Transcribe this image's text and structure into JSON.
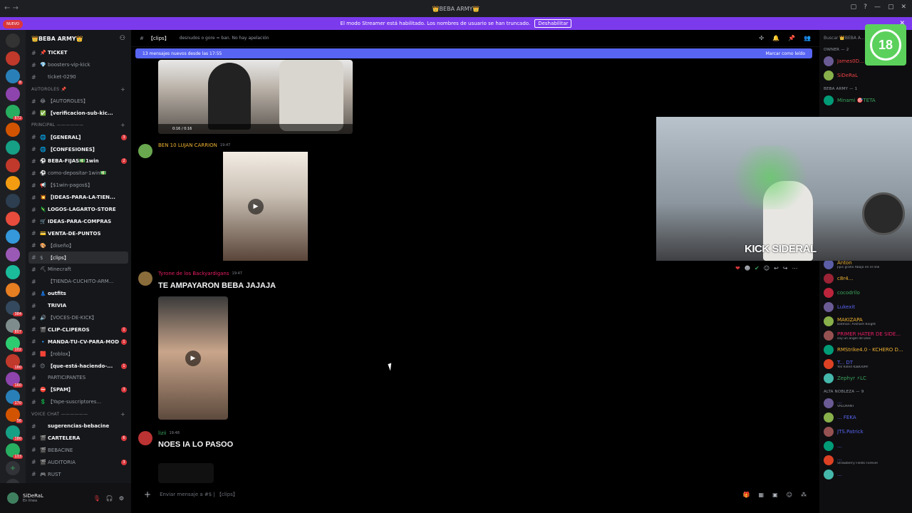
{
  "window": {
    "title": "👑BEBA ARMY👑",
    "nav": "← →",
    "controls": [
      "▢",
      "?",
      "—",
      "▢",
      "✕"
    ]
  },
  "banner": {
    "text": "El modo Streamer está habilitado. Los nombres de usuario se han truncado.",
    "button": "Deshabilitar",
    "close": "✕"
  },
  "rail": {
    "nuevo": "NUEVO",
    "servers": [
      {
        "color": "#333",
        "badge": ""
      },
      {
        "color": "#c0392b",
        "badge": ""
      },
      {
        "color": "#2980b9",
        "badge": "8"
      },
      {
        "color": "#8e44ad",
        "badge": ""
      },
      {
        "color": "#27ae60",
        "badge": "672"
      },
      {
        "color": "#d35400",
        "badge": ""
      },
      {
        "color": "#16a085",
        "badge": ""
      },
      {
        "color": "#c0392b",
        "badge": ""
      },
      {
        "color": "#f39c12",
        "badge": ""
      },
      {
        "color": "#2c3e50",
        "badge": ""
      },
      {
        "color": "#e74c3c",
        "badge": ""
      },
      {
        "color": "#3498db",
        "badge": ""
      },
      {
        "color": "#9b59b6",
        "badge": ""
      },
      {
        "color": "#1abc9c",
        "badge": ""
      },
      {
        "color": "#e67e22",
        "badge": ""
      },
      {
        "color": "#34495e",
        "badge": "384"
      },
      {
        "color": "#7f8c8d",
        "badge": "807"
      },
      {
        "color": "#2ecc71",
        "badge": "102"
      },
      {
        "color": "#c0392b",
        "badge": "180"
      },
      {
        "color": "#8e44ad",
        "badge": "160"
      },
      {
        "color": "#2980b9",
        "badge": "170"
      },
      {
        "color": "#d35400",
        "badge": "56"
      },
      {
        "color": "#16a085",
        "badge": "180"
      },
      {
        "color": "#27ae60",
        "badge": "133"
      }
    ],
    "add": "+",
    "discover": "◎"
  },
  "sidebar": {
    "server_name": "👑BEBA ARMY👑",
    "items": [
      {
        "type": "ch",
        "emoji": "📌",
        "name": "TICKET",
        "bold": true,
        "badge": ""
      },
      {
        "type": "ch",
        "emoji": "💎",
        "name": "boosters-vip-kick",
        "bold": false,
        "badge": ""
      },
      {
        "type": "ch",
        "emoji": "",
        "name": "ticket-0290",
        "bold": false,
        "badge": ""
      },
      {
        "type": "cat",
        "name": "AUTOROLES 📌"
      },
      {
        "type": "ch",
        "emoji": "😂",
        "name": "【AUTOROLES】",
        "bold": false,
        "badge": ""
      },
      {
        "type": "ch",
        "emoji": "✅",
        "name": "【verificacion-sub-kic...",
        "bold": true,
        "badge": ""
      },
      {
        "type": "cat",
        "name": "PRINCIPAL ——————"
      },
      {
        "type": "ch",
        "emoji": "🌐",
        "name": "【GENERAL】",
        "bold": true,
        "badge": "3"
      },
      {
        "type": "ch",
        "emoji": "🌐",
        "name": "【CONFESIONES】",
        "bold": true,
        "badge": ""
      },
      {
        "type": "ch",
        "emoji": "⚽",
        "name": "BEBA-FIJAS💵1win",
        "bold": true,
        "badge": "2"
      },
      {
        "type": "ch",
        "emoji": "⚽",
        "name": "como-depositar-1win💵",
        "bold": false,
        "badge": ""
      },
      {
        "type": "ch",
        "emoji": "📢",
        "name": "【$1win-pagos$】",
        "bold": false,
        "badge": ""
      },
      {
        "type": "ch",
        "emoji": "💥",
        "name": "【IDEAS-PARA-LA-TIEN...",
        "bold": true,
        "badge": ""
      },
      {
        "type": "ch",
        "emoji": "🦎",
        "name": "LOGOS-LAGARTO-STORE",
        "bold": true,
        "badge": ""
      },
      {
        "type": "ch",
        "emoji": "🛒",
        "name": "IDEAS-PARA-COMPRAS",
        "bold": true,
        "badge": ""
      },
      {
        "type": "ch",
        "emoji": "💳",
        "name": "VENTA-DE-PUNTOS",
        "bold": true,
        "badge": ""
      },
      {
        "type": "ch",
        "emoji": "🎨",
        "name": "【diseño】",
        "bold": false,
        "badge": ""
      },
      {
        "type": "ch",
        "emoji": "$",
        "name": "【clips】",
        "bold": false,
        "badge": "",
        "active": true
      },
      {
        "type": "ch",
        "emoji": "⛏",
        "name": "Minecraft",
        "bold": false,
        "badge": ""
      },
      {
        "type": "ch",
        "emoji": "",
        "name": "【TIENDA-CUCHITO-ARM...",
        "bold": false,
        "badge": ""
      },
      {
        "type": "ch",
        "emoji": "👗",
        "name": "outfits",
        "bold": true,
        "badge": ""
      },
      {
        "type": "ch",
        "emoji": "",
        "name": "TRIVIA",
        "bold": true,
        "badge": ""
      },
      {
        "type": "ch",
        "emoji": "🔊",
        "name": "【VOCES-DE-KICK】",
        "bold": false,
        "badge": ""
      },
      {
        "type": "ch",
        "emoji": "🎬",
        "name": "CLIP-CLIPEROS",
        "bold": true,
        "badge": "1"
      },
      {
        "type": "ch",
        "emoji": "🔹",
        "name": "MANDA-TU-CV-PARA-MOD",
        "bold": true,
        "badge": "1"
      },
      {
        "type": "ch",
        "emoji": "🟥",
        "name": "【roblox】",
        "bold": false,
        "badge": ""
      },
      {
        "type": "ch",
        "emoji": "😊",
        "name": "【que-está-haciendo-...",
        "bold": true,
        "badge": "1"
      },
      {
        "type": "ch",
        "emoji": "",
        "name": "PARTICIPANTES",
        "bold": false,
        "badge": ""
      },
      {
        "type": "ch",
        "emoji": "⛔",
        "name": "【SPAM】",
        "bold": true,
        "badge": "3"
      },
      {
        "type": "ch",
        "emoji": "💲",
        "name": "【Yape-suscriptores...",
        "bold": false,
        "badge": ""
      },
      {
        "type": "cat",
        "name": "VOICE CHAT ——————"
      },
      {
        "type": "ch",
        "emoji": "",
        "name": "sugerencias-bebacine",
        "bold": true,
        "badge": ""
      },
      {
        "type": "ch",
        "emoji": "🎬",
        "name": "CARTELERA",
        "bold": true,
        "badge": "6"
      },
      {
        "type": "ch",
        "emoji": "🎬",
        "name": "BEBACINE",
        "bold": false,
        "badge": ""
      },
      {
        "type": "ch",
        "emoji": "🎬",
        "name": "AUDITORIA",
        "bold": false,
        "badge": "3"
      },
      {
        "type": "ch",
        "emoji": "🎮",
        "name": "RUST",
        "bold": false,
        "badge": ""
      }
    ]
  },
  "user": {
    "name": "SiDeRaL",
    "status": "En línea"
  },
  "channel": {
    "name": "【clips】",
    "topic": "desnudos o gore = ban. No hay apelación",
    "new_messages": "13 mensajes nuevos desde las 17:55",
    "mark_read": "Marcar como leído"
  },
  "video_time": "0:16 / 0:16",
  "messages": [
    {
      "author": "BEN 10 LUJAN CARRION",
      "time": "19:47",
      "color": "#f0b232",
      "text": ""
    },
    {
      "author": "Tyrone de los Backyardigans",
      "time": "19:47",
      "color": "#e91e63",
      "text": "TE AMPAYARON BEBA JAJAJA"
    },
    {
      "author": "lizii",
      "time": "19:48",
      "color": "#3ba55d",
      "text": "NOES IA LO PASOO"
    }
  ],
  "composer": {
    "placeholder": "Enviar mensaje a #$ | 【clips】"
  },
  "members": {
    "search": "Buscar 👑BEBA A...",
    "groups": [
      {
        "title": "OWNER — 2",
        "people": [
          {
            "name": "James0D...",
            "sub": "",
            "color": "#ed4245"
          },
          {
            "name": "SiDeRaL",
            "sub": "",
            "color": "#ed4245"
          }
        ]
      },
      {
        "title": "BEBA ARMY — 1",
        "people": [
          {
            "name": "Minami 🎯TETA",
            "sub": "",
            "color": "#3ba55d"
          }
        ]
      },
      {
        "title": "",
        "people": [
          {
            "name": "Anton",
            "sub": "Jipis gratis Abajo en el link",
            "color": "#f0b232"
          },
          {
            "name": "c8r4...",
            "sub": "",
            "color": "#f0b232"
          },
          {
            "name": "cocodrilo",
            "sub": "",
            "color": "#3ba55d"
          },
          {
            "name": "Lukexit",
            "sub": "",
            "color": "#5865f2"
          },
          {
            "name": "MAKIZAPA",
            "sub": "Batman: Arkham Knight",
            "color": "#f0b232"
          },
          {
            "name": "PRIMER HATER DE SIDE...",
            "sub": "soy un angel de Dios",
            "color": "#e91e63"
          },
          {
            "name": "RMStrike4.0 - KCHERO D...",
            "sub": "",
            "color": "#f0b232"
          },
          {
            "name": "T... DT",
            "sub": "Yes Killed KaBOOM!",
            "color": "#5865f2"
          },
          {
            "name": "Zephyr ⚡LC",
            "sub": "",
            "color": "#3ba55d"
          }
        ]
      },
      {
        "title": "ALTA NOBLEZA — 9",
        "people": [
          {
            "name": "...",
            "sub": "VALORANT",
            "color": "#5865f2"
          },
          {
            "name": "... FEKA",
            "sub": "",
            "color": "#5865f2"
          },
          {
            "name": "JTS.Patrick",
            "sub": "",
            "color": "#5865f2"
          },
          {
            "name": "...",
            "sub": "",
            "color": "#5865f2"
          },
          {
            "name": "...",
            "sub": "Strawberry Fields Forever",
            "color": "#5865f2"
          },
          {
            "name": "...",
            "sub": "",
            "color": "#5865f2"
          }
        ]
      }
    ]
  },
  "webcam": {
    "label": "KICK SIDERAL"
  },
  "rating": {
    "value": "18"
  }
}
